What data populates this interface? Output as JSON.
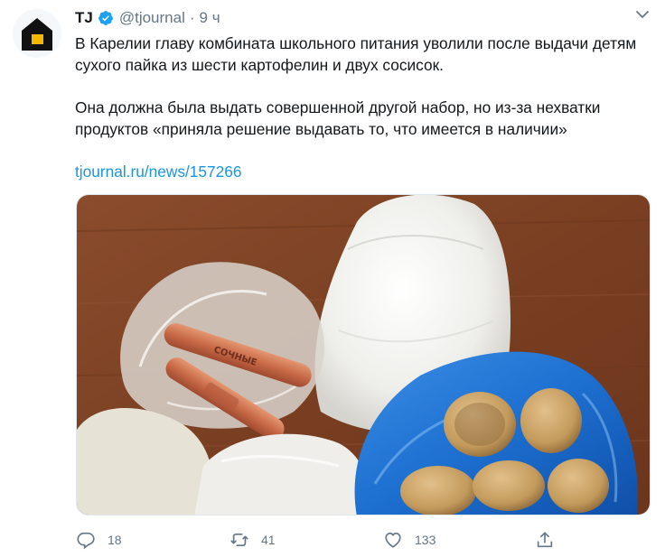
{
  "tweet": {
    "author_name": "TJ",
    "author_handle": "@tjournal",
    "separator": "·",
    "time": "9 ч",
    "text_line1": "В Карелии главу комбината школьного питания уволили после выдачи детям сухого пайка из шести картофелин и двух сосисок.",
    "text_line2": "Она должна была выдать совершенной другой набор, но из-за нехватки продуктов «приняла решение выдавать то, что имеется в наличии»",
    "link": "tjournal.ru/news/157266",
    "sausage_label": "СОЧНЫЕ",
    "icons": {
      "avatar": "house-logo-icon",
      "verified": "verified-badge-icon",
      "caret": "chevron-down-icon",
      "reply": "reply-icon",
      "retweet": "retweet-icon",
      "like": "heart-icon",
      "share": "share-icon"
    }
  },
  "actions": {
    "replies": "18",
    "retweets": "41",
    "likes": "133"
  },
  "colors": {
    "text": "#14171a",
    "secondary": "#657786",
    "link": "#1b95e0",
    "verified": "#1da1f2",
    "logo_bg": "#111111",
    "logo_accent": "#f5b800"
  }
}
